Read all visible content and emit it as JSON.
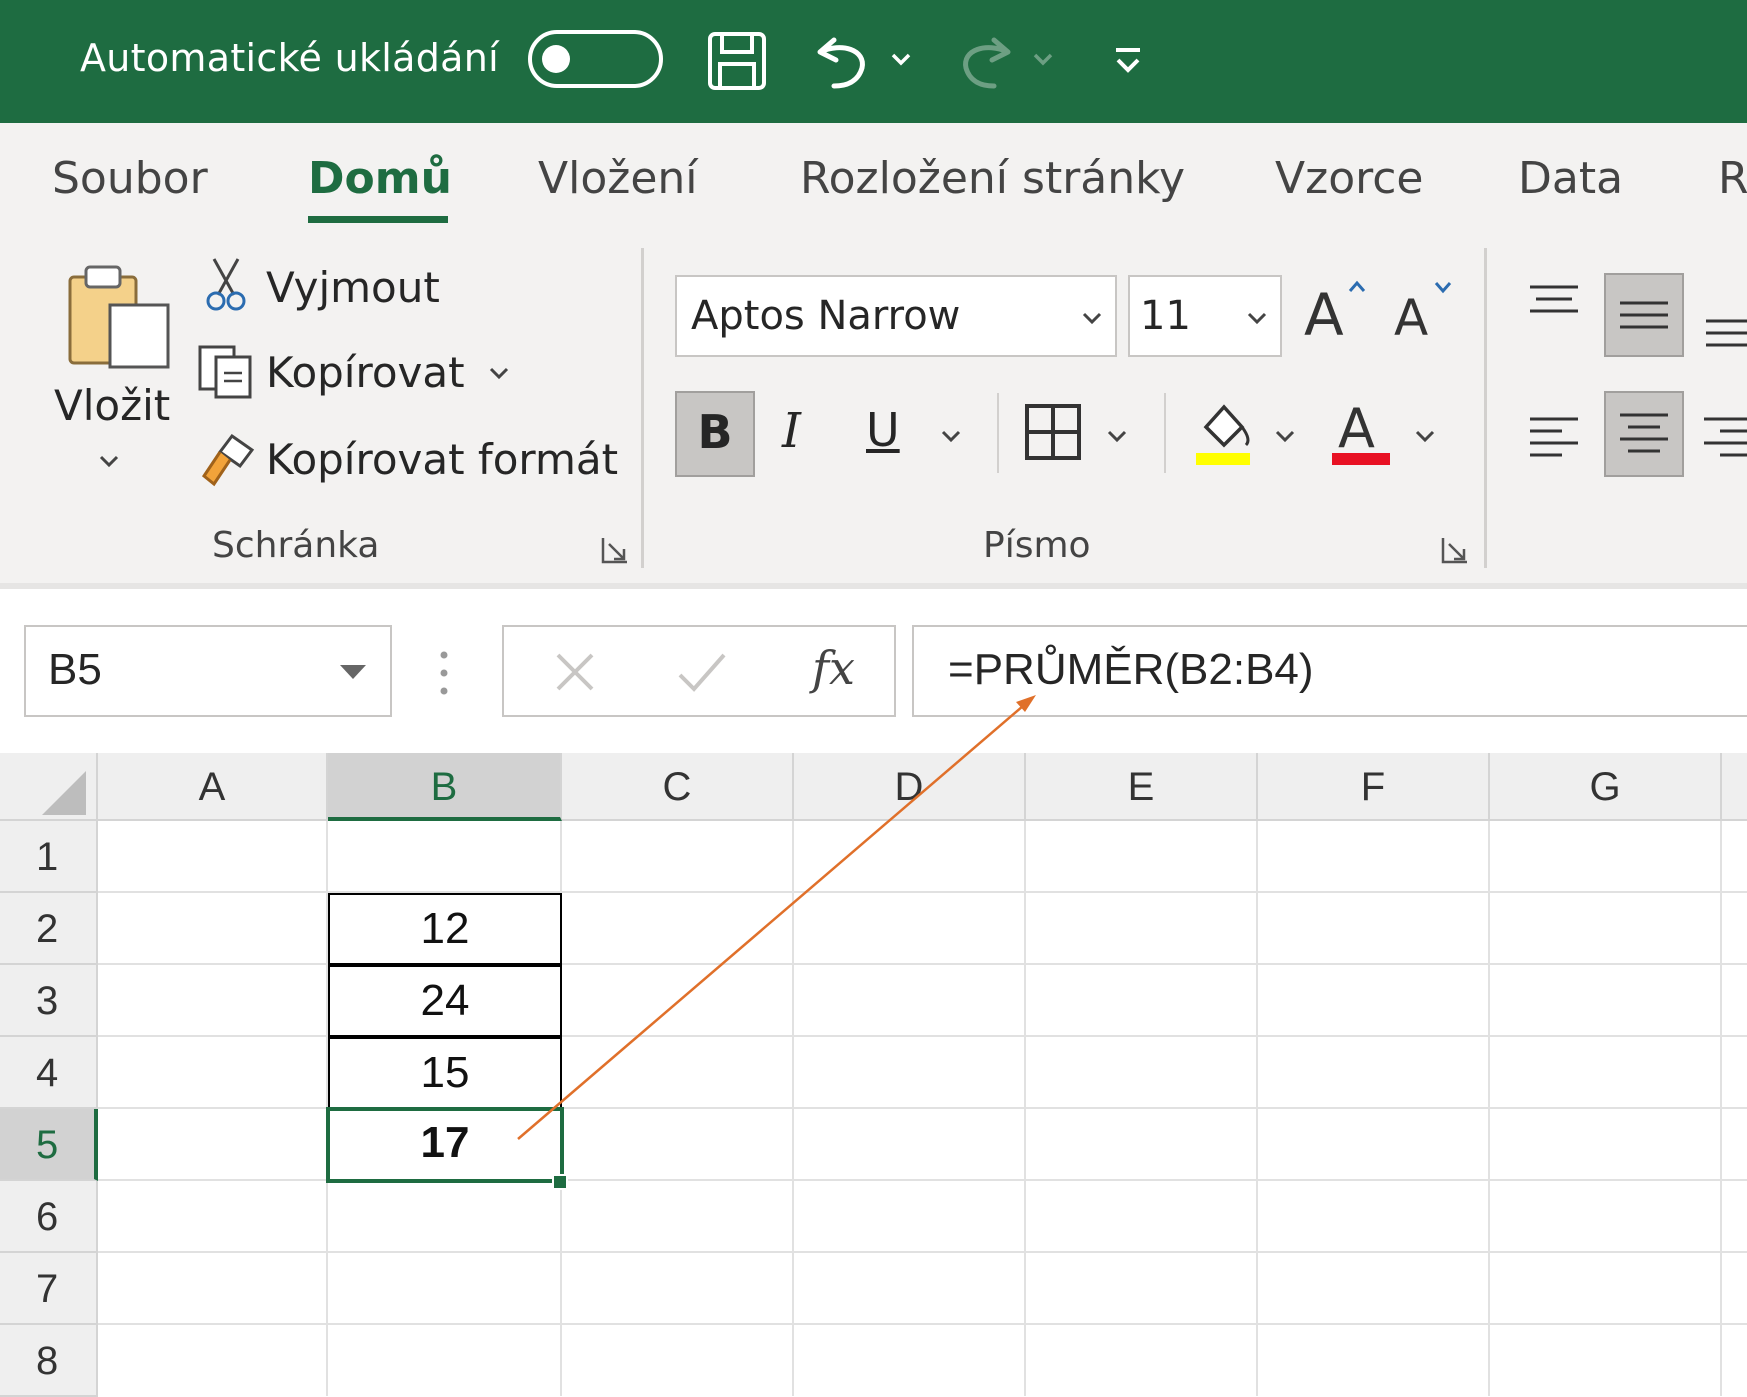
{
  "titlebar": {
    "autosave_label": "Automatické ukládání",
    "autosave_state": "off",
    "icons": [
      "save-icon",
      "undo-icon",
      "redo-icon",
      "customize-quick-access-icon"
    ]
  },
  "ribbon": {
    "tabs": [
      {
        "label": "Soubor"
      },
      {
        "label": "Domů",
        "active": true
      },
      {
        "label": "Vložení"
      },
      {
        "label": "Rozložení stránky"
      },
      {
        "label": "Vzorce"
      },
      {
        "label": "Data"
      },
      {
        "label": "R"
      }
    ],
    "clipboard": {
      "paste_label": "Vložit",
      "cut_label": "Vyjmout",
      "copy_label": "Kopírovat",
      "format_painter_label": "Kopírovat formát",
      "group_label": "Schránka"
    },
    "font": {
      "font_name": "Aptos Narrow",
      "font_size": "11",
      "bold_label": "B",
      "italic_label": "I",
      "underline_label": "U",
      "group_label": "Písmo",
      "fill_color": "#ffff00",
      "font_color": "#e81123"
    }
  },
  "formula_bar": {
    "name_box": "B5",
    "fx_label": "fx",
    "formula": "=PRŮMĚR(B2:B4)"
  },
  "sheet": {
    "columns": [
      "A",
      "B",
      "C",
      "D",
      "E",
      "F",
      "G"
    ],
    "rows": [
      "1",
      "2",
      "3",
      "4",
      "5",
      "6",
      "7",
      "8"
    ],
    "cells": {
      "B2": "12",
      "B3": "24",
      "B4": "15",
      "B5": "17"
    },
    "active_cell": "B5",
    "accent_color": "#1e6c41",
    "annotation_arrow_color": "#e0702a"
  }
}
